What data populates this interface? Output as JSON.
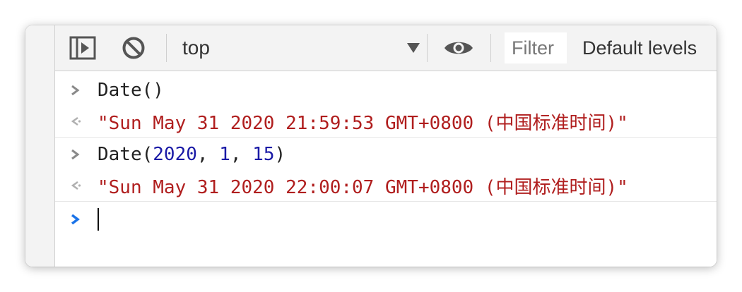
{
  "toolbar": {
    "sidebar_toggle_icon": "sidebar-toggle-icon",
    "clear_icon": "clear-console-icon",
    "context": "top",
    "context_dropdown_icon": "triangle-down-icon",
    "eye_icon": "eye-icon",
    "filter_placeholder": "Filter",
    "levels_label": "Default levels"
  },
  "console": {
    "entries": [
      {
        "type": "input",
        "text": "Date()"
      },
      {
        "type": "output",
        "text": "\"Sun May 31 2020 21:59:53 GMT+0800 (中国标准时间)\""
      },
      {
        "type": "input",
        "fn": "Date(",
        "args": [
          "2020",
          "1",
          "15"
        ],
        "close": ")"
      },
      {
        "type": "output",
        "text": "\"Sun May 31 2020 22:00:07 GMT+0800 (中国标准时间)\""
      }
    ],
    "prompt_value": ""
  },
  "colors": {
    "string": "#b01e1e",
    "number": "#1a1aa6",
    "prompt": "#1a73e8",
    "chevron": "#8a8a8a"
  }
}
